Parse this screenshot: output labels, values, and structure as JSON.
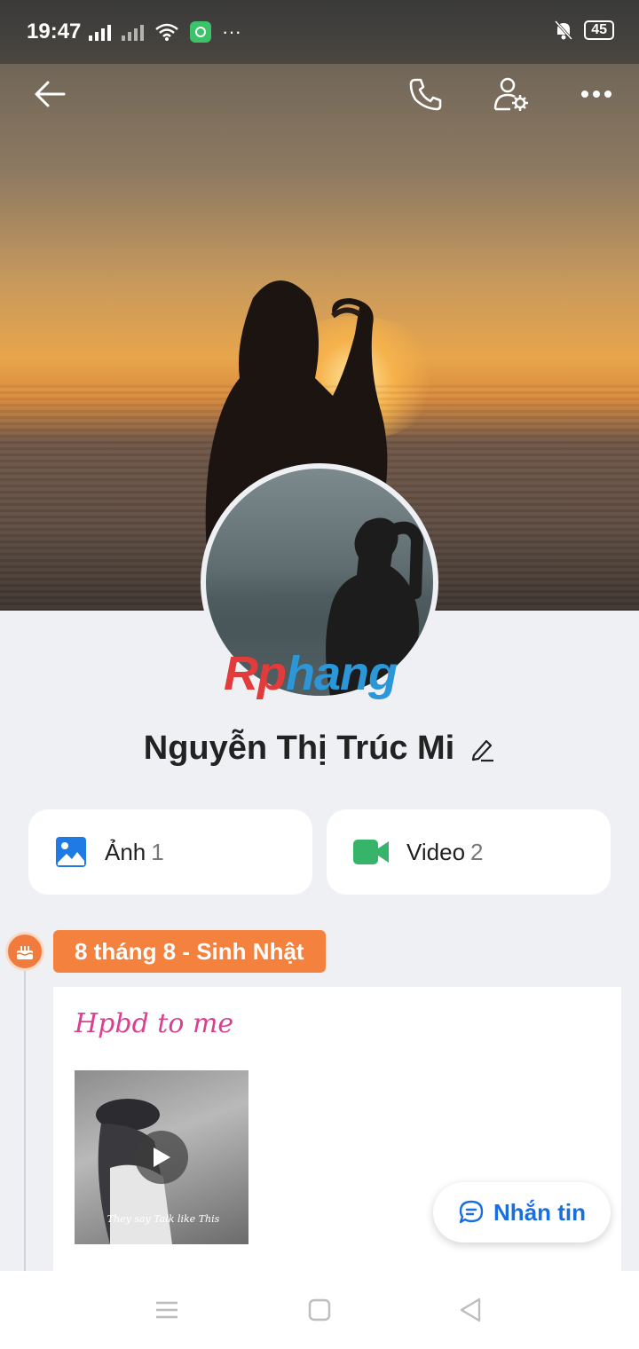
{
  "status_bar": {
    "time": "19:47",
    "battery": "45",
    "more": "···"
  },
  "header": {
    "icons": [
      "back-arrow-icon",
      "phone-icon",
      "user-settings-icon",
      "more-icon"
    ]
  },
  "profile": {
    "name": "Nguyễn Thị Trúc Mi",
    "watermark_part1": "Rp",
    "watermark_part2": "hang"
  },
  "media": {
    "photos": {
      "label": "Ảnh",
      "count": "1"
    },
    "videos": {
      "label": "Video",
      "count": "2"
    }
  },
  "timeline": {
    "tag": "8 tháng 8 - Sinh Nhật",
    "post": {
      "caption": "Hpbd to me",
      "thumb_text": "They say Talk like This"
    }
  },
  "actions": {
    "message_label": "Nhắn tin"
  },
  "colors": {
    "accent_blue": "#1a6fe0",
    "birthday_orange": "#f5813f",
    "caption_pink": "#d9408f",
    "video_green": "#35b46a",
    "photo_blue": "#1f7ae6"
  }
}
